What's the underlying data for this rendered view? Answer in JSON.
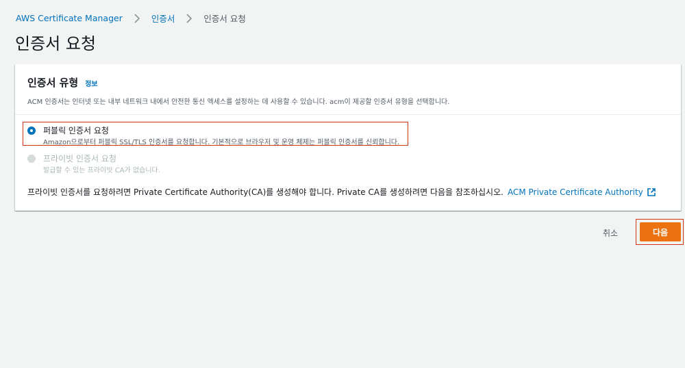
{
  "breadcrumb": {
    "items": [
      {
        "label": "AWS Certificate Manager"
      },
      {
        "label": "인증서"
      },
      {
        "label": "인증서 요청"
      }
    ]
  },
  "page": {
    "title": "인증서 요청"
  },
  "panel": {
    "title": "인증서 유형",
    "info_label": "정보",
    "description": "ACM 인증서는 인터넷 또는 내부 네트워크 내에서 안전한 통신 액세스를 설정하는 데 사용할 수 있습니다. acm이 제공할 인증서 유형을 선택합니다.",
    "options": [
      {
        "label": "퍼블릭 인증서 요청",
        "sublabel": "Amazon으로부터 퍼블릭 SSL/TLS 인증서를 요청합니다. 기본적으로 브라우저 및 운영 체제는 퍼블릭 인증서를 신뢰합니다.",
        "selected": true,
        "disabled": false
      },
      {
        "label": "프라이빗 인증서 요청",
        "sublabel": "발급할 수 있는 프라이빗 CA가 없습니다.",
        "selected": false,
        "disabled": true
      }
    ],
    "private_note": "프라이빗 인증서를 요청하려면 Private Certificate Authority(CA)를 생성해야 합니다. Private CA를 생성하려면 다음을 참조하십시오.",
    "private_note_link": "ACM Private Certificate Authority",
    "private_note_link_icon": "external-link-icon"
  },
  "actions": {
    "cancel_label": "취소",
    "next_label": "다음"
  },
  "colors": {
    "accent_link": "#0073bb",
    "primary_button": "#ec7211",
    "highlight_border": "#d13212",
    "background": "#f2f3f3"
  }
}
